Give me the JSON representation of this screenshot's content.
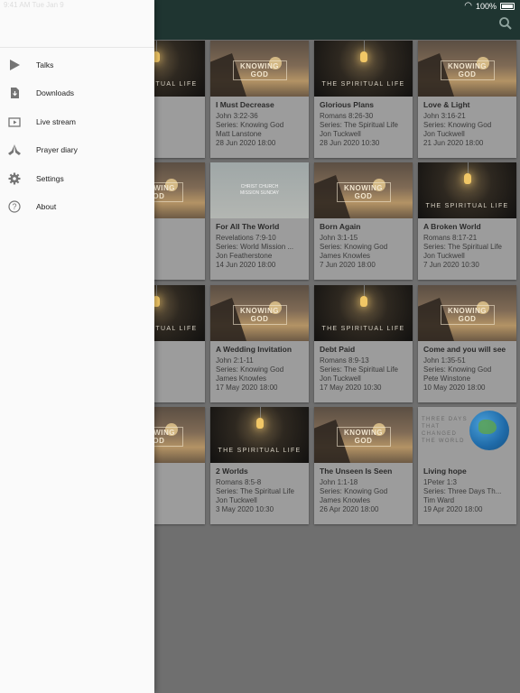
{
  "status": {
    "time": "9:41 AM",
    "date": "Tue Jan 9",
    "battery": "100%"
  },
  "drawer": {
    "items": [
      {
        "label": "Talks",
        "icon": "play-icon"
      },
      {
        "label": "Downloads",
        "icon": "download-icon"
      },
      {
        "label": "Live stream",
        "icon": "live-stream-icon"
      },
      {
        "label": "Prayer diary",
        "icon": "praying-hands-icon"
      },
      {
        "label": "Settings",
        "icon": "gear-icon"
      },
      {
        "label": "About",
        "icon": "help-circle-icon"
      }
    ]
  },
  "thumb_labels": {
    "knowing_god": "KNOWING GOD",
    "spiritual_life": "THE SPIRITUAL LIFE",
    "mission_sunday": "CHRIST CHURCH\nMISSION SUNDAY",
    "three_days": "THREE DAYS\nTHAT\nCHANGED\nTHE WORLD"
  },
  "talks": [
    {
      "title": "Us!",
      "ref": "1-32",
      "series": "Spiritual Life",
      "speaker": "",
      "date": "0:30",
      "thumb": "sl"
    },
    {
      "title": "I Must Decrease",
      "ref": "John 3:22-36",
      "series": "Series: Knowing God",
      "speaker": "Matt Lanstone",
      "date": "28 Jun 2020 18:00",
      "thumb": "kg"
    },
    {
      "title": "Glorious Plans",
      "ref": "Romans 8:26-30",
      "series": "Series: The Spiritual Life",
      "speaker": "Jon Tuckwell",
      "date": "28 Jun 2020 10:30",
      "thumb": "sl"
    },
    {
      "title": "Love & Light",
      "ref": "John 3:16-21",
      "series": "Series: Knowing God",
      "speaker": "Jon Tuckwell",
      "date": "21 Jun 2020 18:00",
      "thumb": "kg"
    },
    {
      "title": "od",
      "ref": "",
      "series": "wing God",
      "speaker": "wles",
      "date": "18:00",
      "thumb": "kg"
    },
    {
      "title": "For All The World",
      "ref": "Revelations 7:9-10",
      "series": "Series: World Mission ...",
      "speaker": "Jon Featherstone",
      "date": "14 Jun 2020 18:00",
      "thumb": "ms"
    },
    {
      "title": "Born Again",
      "ref": "John 3:1-15",
      "series": "Series: Knowing God",
      "speaker": "James Knowles",
      "date": "7 Jun 2020 18:00",
      "thumb": "kg"
    },
    {
      "title": "A Broken World",
      "ref": "Romans 8:17-21",
      "series": "Series: The Spiritual Life",
      "speaker": "Jon Tuckwell",
      "date": "7 Jun 2020 10:30",
      "thumb": "sl"
    },
    {
      "title": "ot Slaves",
      "ref": "-17",
      "series": "Spiritual Life",
      "speaker": "",
      "date": "0 10:30",
      "thumb": "sl"
    },
    {
      "title": "A Wedding Invitation",
      "ref": "John 2:1-11",
      "series": "Series: Knowing God",
      "speaker": "James Knowles",
      "date": "17 May 2020 18:00",
      "thumb": "kg"
    },
    {
      "title": "Debt Paid",
      "ref": "Romans 8:9-13",
      "series": "Series: The Spiritual Life",
      "speaker": "Jon Tuckwell",
      "date": "17 May 2020 10:30",
      "thumb": "sl"
    },
    {
      "title": "Come and you will see",
      "ref": "John 1:35-51",
      "series": "Series: Knowing God",
      "speaker": "Pete Winstone",
      "date": "10 May 2020 18:00",
      "thumb": "kg"
    },
    {
      "title": "",
      "ref": "4",
      "series": "wing God",
      "speaker": "stone",
      "date": "18:00",
      "thumb": "kg"
    },
    {
      "title": "2 Worlds",
      "ref": "Romans 8:5-8",
      "series": "Series: The Spiritual Life",
      "speaker": "Jon Tuckwell",
      "date": "3 May 2020 10:30",
      "thumb": "sl"
    },
    {
      "title": "The Unseen Is Seen",
      "ref": "John 1:1-18",
      "series": "Series: Knowing God",
      "speaker": "James Knowles",
      "date": "26 Apr 2020 18:00",
      "thumb": "kg"
    },
    {
      "title": "Living hope",
      "ref": "1Peter 1:3",
      "series": "Series: Three Days Th...",
      "speaker": "Tim Ward",
      "date": "19 Apr 2020 18:00",
      "thumb": "tdc"
    }
  ]
}
